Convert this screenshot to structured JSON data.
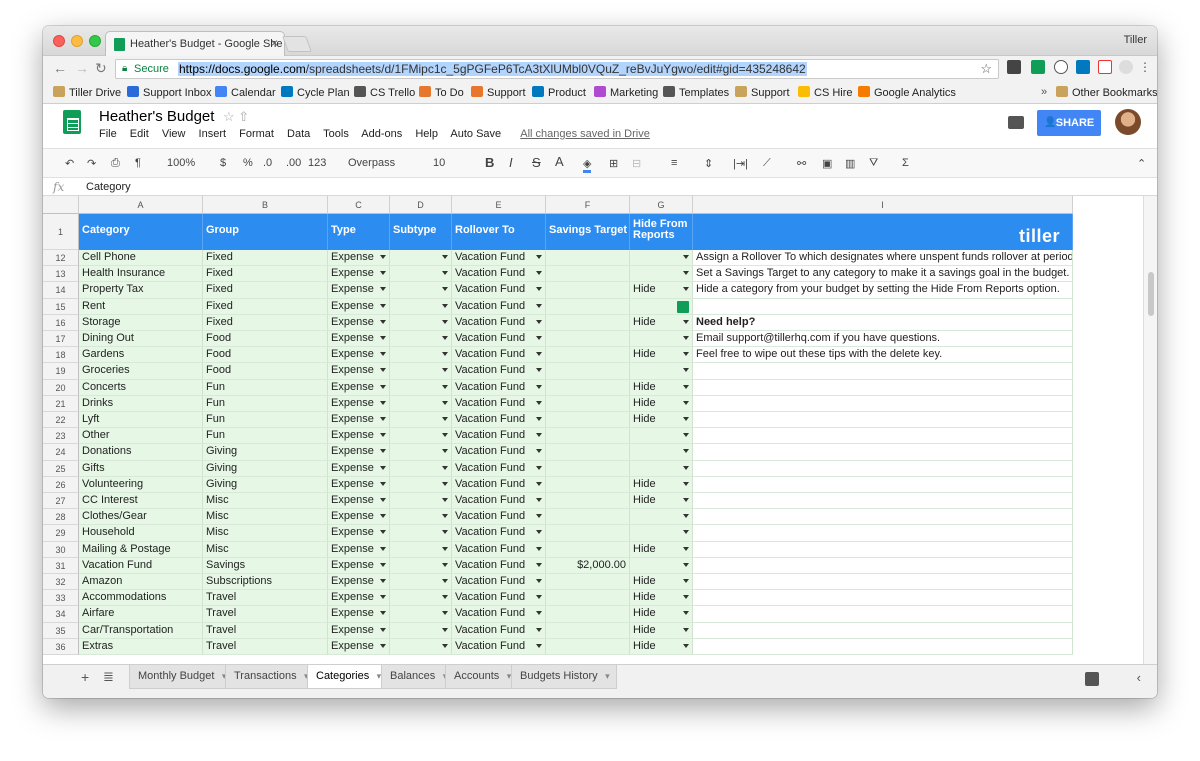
{
  "browser": {
    "tab_title": "Heather's Budget - Google She",
    "profile": "Tiller",
    "secure_label": "Secure",
    "url_host": "https://docs.google.com",
    "url_path": "/spreadsheets/d/1FMipc1c_5gPGFeP6TcA3tXlUMbl0VQuZ_reBvJuYgwo/edit#gid=435248642",
    "bookmarks": [
      "Tiller Drive",
      "Support Inbox",
      "Calendar",
      "Cycle Plan",
      "CS Trello",
      "To Do",
      "Support",
      "Product",
      "Marketing",
      "Templates",
      "Support",
      "CS Hire",
      "Google Analytics"
    ],
    "other_bookmarks": "Other Bookmarks"
  },
  "sheets": {
    "doc_title": "Heather's Budget",
    "menus": [
      "File",
      "Edit",
      "View",
      "Insert",
      "Format",
      "Data",
      "Tools",
      "Add-ons",
      "Help",
      "Auto Save"
    ],
    "saved_status": "All changes saved in Drive",
    "share_label": "SHARE",
    "toolbar": {
      "zoom": "100%",
      "currency": "$",
      "percent": "%",
      "dec_less": ".0",
      "dec_more": ".00",
      "format": "123",
      "font": "Overpass",
      "size": "10"
    },
    "formula_value": "Category"
  },
  "columns": [
    "A",
    "B",
    "C",
    "D",
    "E",
    "F",
    "G",
    "I"
  ],
  "header_row": {
    "num": "1",
    "category": "Category",
    "group": "Group",
    "type": "Type",
    "subtype": "Subtype",
    "rollover": "Rollover To",
    "savings": "Savings Target",
    "hide_line1": "Hide From",
    "hide_line2": "Reports",
    "logo": "tiller"
  },
  "rows": [
    {
      "n": "12",
      "cat": "Cell Phone",
      "grp": "Fixed",
      "type": "Expense",
      "roll": "Vacation Fund",
      "sav": "",
      "hide": "",
      "note": "Assign a Rollover To which designates where unspent funds rollover at period end."
    },
    {
      "n": "13",
      "cat": "Health Insurance",
      "grp": "Fixed",
      "type": "Expense",
      "roll": "Vacation Fund",
      "sav": "",
      "hide": "",
      "note": "Set a Savings Target to any category to make it a savings goal in the budget."
    },
    {
      "n": "14",
      "cat": "Property Tax",
      "grp": "Fixed",
      "type": "Expense",
      "roll": "Vacation Fund",
      "sav": "",
      "hide": "Hide",
      "note": "Hide a category from your budget by setting the Hide From Reports option."
    },
    {
      "n": "15",
      "cat": "Rent",
      "grp": "Fixed",
      "type": "Expense",
      "roll": "Vacation Fund",
      "sav": "",
      "hide": "",
      "note": ""
    },
    {
      "n": "16",
      "cat": "Storage",
      "grp": "Fixed",
      "type": "Expense",
      "roll": "Vacation Fund",
      "sav": "",
      "hide": "Hide",
      "note": "Need help?"
    },
    {
      "n": "17",
      "cat": "Dining Out",
      "grp": "Food",
      "type": "Expense",
      "roll": "Vacation Fund",
      "sav": "",
      "hide": "",
      "note": "Email support@tillerhq.com if you have questions."
    },
    {
      "n": "18",
      "cat": "Gardens",
      "grp": "Food",
      "type": "Expense",
      "roll": "Vacation Fund",
      "sav": "",
      "hide": "Hide",
      "note": "Feel free to wipe out these tips with the delete key."
    },
    {
      "n": "19",
      "cat": "Groceries",
      "grp": "Food",
      "type": "Expense",
      "roll": "Vacation Fund",
      "sav": "",
      "hide": "",
      "note": ""
    },
    {
      "n": "20",
      "cat": "Concerts",
      "grp": "Fun",
      "type": "Expense",
      "roll": "Vacation Fund",
      "sav": "",
      "hide": "Hide",
      "note": ""
    },
    {
      "n": "21",
      "cat": "Drinks",
      "grp": "Fun",
      "type": "Expense",
      "roll": "Vacation Fund",
      "sav": "",
      "hide": "Hide",
      "note": ""
    },
    {
      "n": "22",
      "cat": "Lyft",
      "grp": "Fun",
      "type": "Expense",
      "roll": "Vacation Fund",
      "sav": "",
      "hide": "Hide",
      "note": ""
    },
    {
      "n": "23",
      "cat": "Other",
      "grp": "Fun",
      "type": "Expense",
      "roll": "Vacation Fund",
      "sav": "",
      "hide": "",
      "note": ""
    },
    {
      "n": "24",
      "cat": "Donations",
      "grp": "Giving",
      "type": "Expense",
      "roll": "Vacation Fund",
      "sav": "",
      "hide": "",
      "note": ""
    },
    {
      "n": "25",
      "cat": "Gifts",
      "grp": "Giving",
      "type": "Expense",
      "roll": "Vacation Fund",
      "sav": "",
      "hide": "",
      "note": ""
    },
    {
      "n": "26",
      "cat": "Volunteering",
      "grp": "Giving",
      "type": "Expense",
      "roll": "Vacation Fund",
      "sav": "",
      "hide": "Hide",
      "note": ""
    },
    {
      "n": "27",
      "cat": "CC Interest",
      "grp": "Misc",
      "type": "Expense",
      "roll": "Vacation Fund",
      "sav": "",
      "hide": "Hide",
      "note": ""
    },
    {
      "n": "28",
      "cat": "Clothes/Gear",
      "grp": "Misc",
      "type": "Expense",
      "roll": "Vacation Fund",
      "sav": "",
      "hide": "",
      "note": ""
    },
    {
      "n": "29",
      "cat": "Household",
      "grp": "Misc",
      "type": "Expense",
      "roll": "Vacation Fund",
      "sav": "",
      "hide": "",
      "note": ""
    },
    {
      "n": "30",
      "cat": "Mailing & Postage",
      "grp": "Misc",
      "type": "Expense",
      "roll": "Vacation Fund",
      "sav": "",
      "hide": "Hide",
      "note": ""
    },
    {
      "n": "31",
      "cat": "Vacation Fund",
      "grp": "Savings",
      "type": "Expense",
      "roll": "Vacation Fund",
      "sav": "$2,000.00",
      "hide": "",
      "note": ""
    },
    {
      "n": "32",
      "cat": "Amazon",
      "grp": "Subscriptions",
      "type": "Expense",
      "roll": "Vacation Fund",
      "sav": "",
      "hide": "Hide",
      "note": ""
    },
    {
      "n": "33",
      "cat": "Accommodations",
      "grp": "Travel",
      "type": "Expense",
      "roll": "Vacation Fund",
      "sav": "",
      "hide": "Hide",
      "note": ""
    },
    {
      "n": "34",
      "cat": "Airfare",
      "grp": "Travel",
      "type": "Expense",
      "roll": "Vacation Fund",
      "sav": "",
      "hide": "Hide",
      "note": ""
    },
    {
      "n": "35",
      "cat": "Car/Transportation",
      "grp": "Travel",
      "type": "Expense",
      "roll": "Vacation Fund",
      "sav": "",
      "hide": "Hide",
      "note": ""
    },
    {
      "n": "36",
      "cat": "Extras",
      "grp": "Travel",
      "type": "Expense",
      "roll": "Vacation Fund",
      "sav": "",
      "hide": "Hide",
      "note": ""
    }
  ],
  "sheet_tabs": [
    "Monthly Budget",
    "Transactions",
    "Categories",
    "Balances",
    "Accounts",
    "Budgets History"
  ],
  "active_tab": "Categories",
  "colors": {
    "accent": "#2d8cf0",
    "cell_green": "#e6f7e6",
    "sheets_green": "#0f9d58"
  }
}
